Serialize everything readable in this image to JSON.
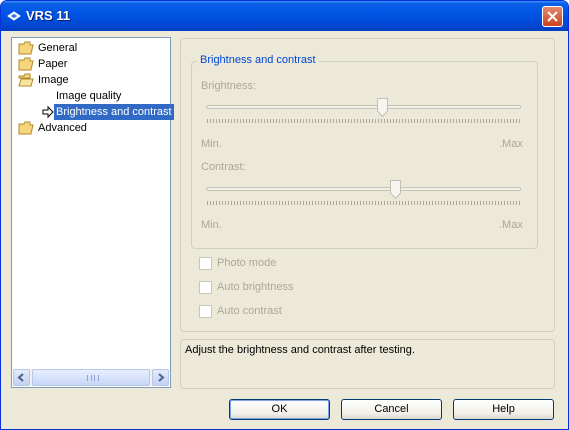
{
  "window": {
    "title": "VRS 11"
  },
  "tree": {
    "items": [
      {
        "label": "General"
      },
      {
        "label": "Paper"
      },
      {
        "label": "Image"
      },
      {
        "label": "Image quality"
      },
      {
        "label": "Brightness and contrast",
        "selected": true
      },
      {
        "label": "Advanced"
      }
    ],
    "grip": "III"
  },
  "group": {
    "title": "Brightness and contrast",
    "brightness": {
      "label": "Brightness:",
      "min": "Min.",
      "max": ".Max",
      "value": 0.56
    },
    "contrast": {
      "label": "Contrast:",
      "min": "Min.",
      "max": ".Max",
      "value": 0.6
    }
  },
  "options": {
    "photo_mode": {
      "label": "Photo mode",
      "checked": false
    },
    "auto_brightness": {
      "label": "Auto brightness",
      "checked": false
    },
    "auto_contrast": {
      "label": "Auto contrast",
      "checked": false
    }
  },
  "description": "Adjust the brightness and contrast after testing.",
  "buttons": {
    "ok": "OK",
    "cancel": "Cancel",
    "help": "Help"
  },
  "colors": {
    "titlebar": "#0055e5",
    "selection": "#316ac5",
    "group_title": "#0046d5",
    "disabled_text": "#aca899"
  }
}
